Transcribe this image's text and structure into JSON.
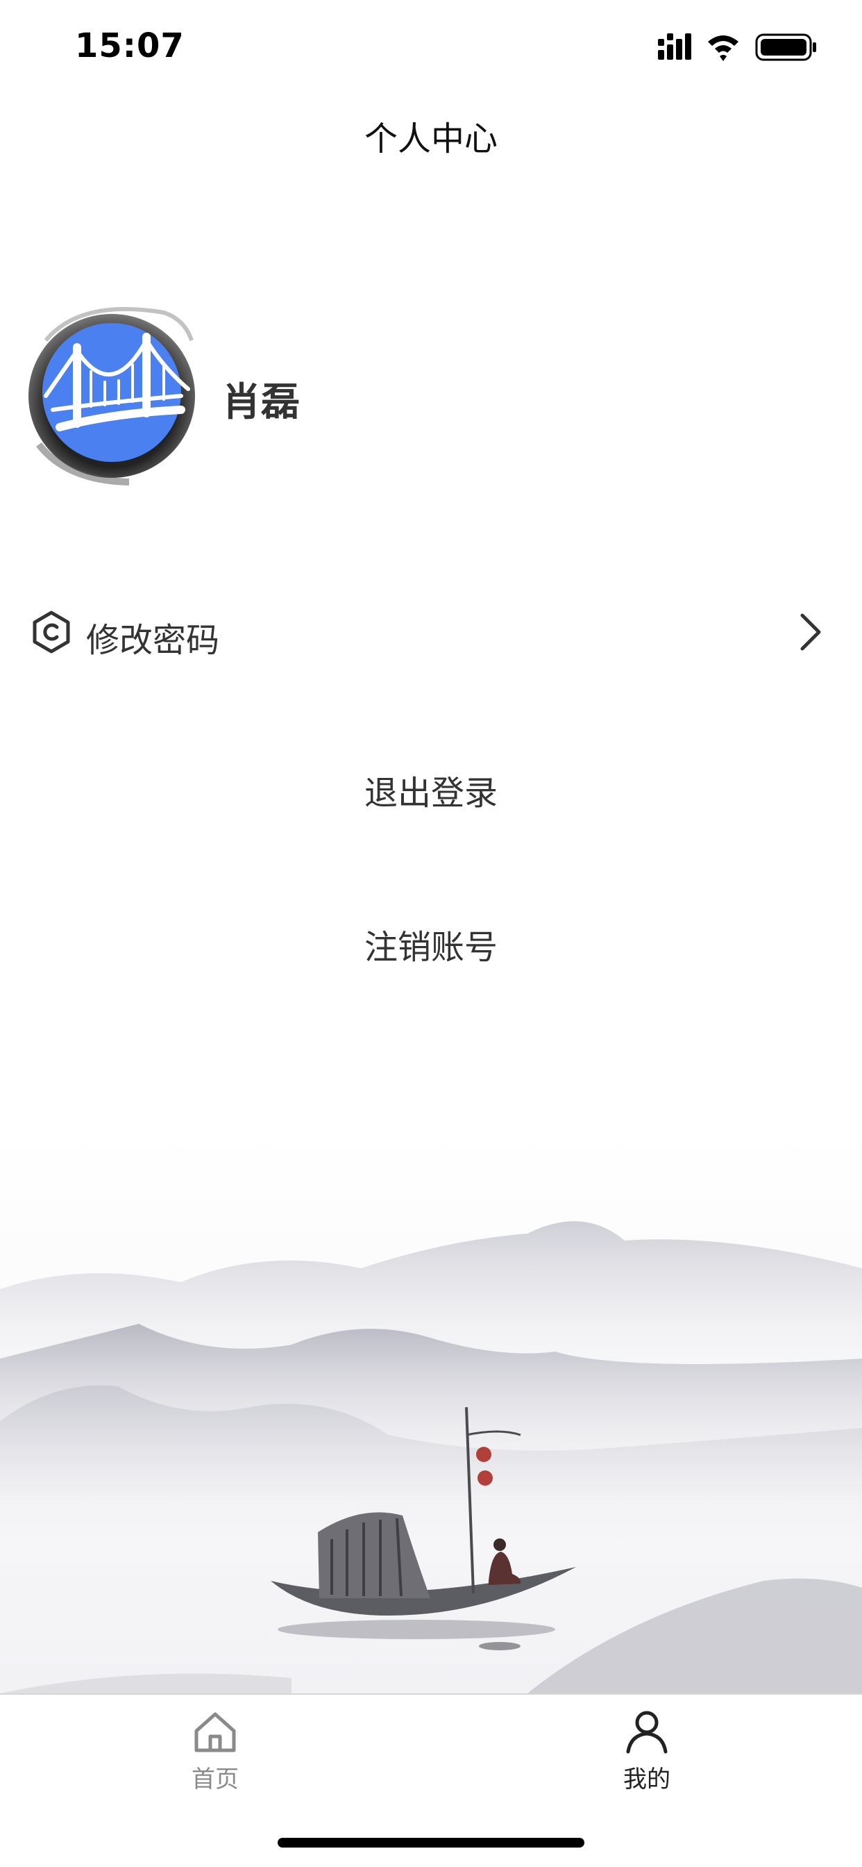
{
  "status_bar": {
    "time": "15:07",
    "icons": [
      "signal-icon",
      "wifi-icon",
      "battery-icon"
    ]
  },
  "header": {
    "title": "个人中心"
  },
  "profile": {
    "name": "肖磊",
    "avatar_icon": "bridge-logo-icon"
  },
  "menu": {
    "items": [
      {
        "label": "修改密码",
        "icon": "password-hex-icon",
        "arrow": "chevron-right-icon"
      }
    ]
  },
  "actions": {
    "logout": "退出登录",
    "cancel_account": "注销账号"
  },
  "tabbar": {
    "items": [
      {
        "label": "首页",
        "icon": "home-icon",
        "active": false
      },
      {
        "label": "我的",
        "icon": "user-icon",
        "active": true
      }
    ]
  },
  "colors": {
    "brand_blue": "#4a80f0",
    "active_tab": "#222222",
    "inactive_tab": "#8a8a8a"
  }
}
